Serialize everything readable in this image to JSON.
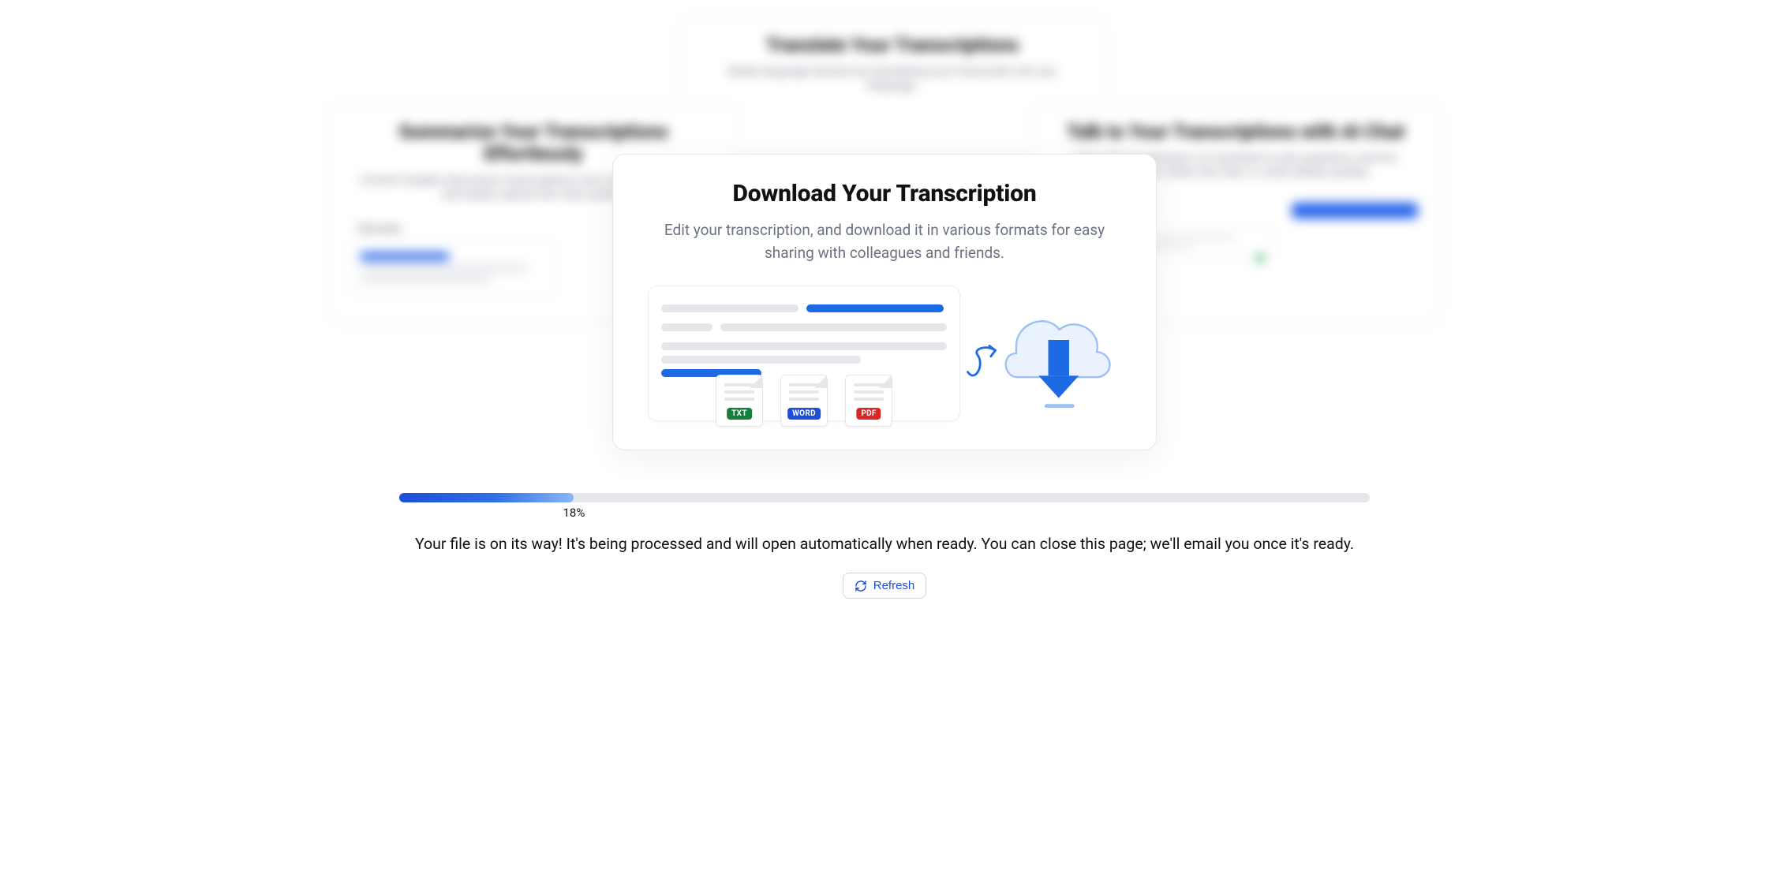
{
  "background": {
    "top": {
      "title": "Translate Your Transcriptions",
      "desc": "Break language barriers by translating your transcripts into any language."
    },
    "left": {
      "title": "Summarize Your Transcriptions Effortlessly",
      "desc": "Convert lengthy discussion transcriptions into concise summaries and easily capture the main points.",
      "mini_label": "Summary"
    },
    "right": {
      "title": "Talk to Your Transcriptions with AI Chat",
      "desc": "Chat with Transkriptor's AI assistant to ask questions, look for information within the chat, or verify details quickly."
    }
  },
  "card": {
    "title": "Download Your Transcription",
    "desc": "Edit your transcription, and download it in various formats for easy sharing with colleagues and friends.",
    "formats": {
      "txt": "TXT",
      "word": "WORD",
      "pdf": "PDF"
    }
  },
  "progress": {
    "percent": 18,
    "percent_label": "18%",
    "status": "Your file is on its way! It's being processed and will open automatically when ready. You can close this page; we'll email you once it's ready.",
    "refresh_label": "Refresh"
  }
}
